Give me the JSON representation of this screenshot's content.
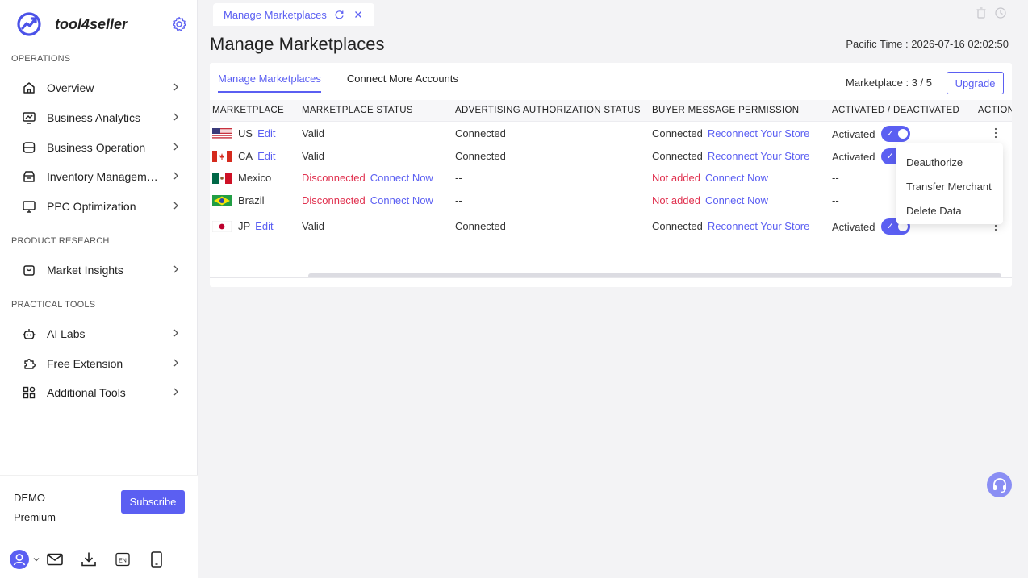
{
  "brand": {
    "name": "tool4seller"
  },
  "sidebar": {
    "sections": [
      {
        "title": "OPERATIONS"
      },
      {
        "title": "PRODUCT RESEARCH"
      },
      {
        "title": "PRACTICAL TOOLS"
      }
    ],
    "items": [
      {
        "label": "Overview",
        "icon": "home-icon"
      },
      {
        "label": "Business Analytics",
        "icon": "analytics-icon"
      },
      {
        "label": "Business Operation",
        "icon": "operation-icon"
      },
      {
        "label": "Inventory Management",
        "icon": "inventory-icon"
      },
      {
        "label": "PPC Optimization",
        "icon": "monitor-icon"
      },
      {
        "label": "Market Insights",
        "icon": "bag-icon"
      },
      {
        "label": "AI Labs",
        "icon": "robot-icon"
      },
      {
        "label": "Free Extension",
        "icon": "puzzle-icon"
      },
      {
        "label": "Additional Tools",
        "icon": "grid-icon"
      }
    ],
    "footer": {
      "plan_name": "DEMO",
      "plan_tier": "Premium",
      "subscribe_label": "Subscribe",
      "lang_label": "EN"
    }
  },
  "tabbar": {
    "tab_label": "Manage Marketplaces"
  },
  "header": {
    "title": "Manage Marketplaces",
    "pacific_time": "Pacific Time : 2026-07-16 02:02:50"
  },
  "card": {
    "subtabs": [
      "Manage Marketplaces",
      "Connect More Accounts"
    ],
    "marketplace_count": "Marketplace : 3 / 5",
    "upgrade_label": "Upgrade",
    "columns": [
      "MARKETPLACE",
      "MARKETPLACE STATUS",
      "ADVERTISING AUTHORIZATION STATUS",
      "BUYER MESSAGE PERMISSION",
      "ACTIVATED / DEACTIVATED",
      "ACTION"
    ],
    "rows": [
      {
        "flag": "us",
        "name": "US",
        "edit": "Edit",
        "status": "Valid",
        "status_link": "",
        "ad_status": "Connected",
        "buyer": "Connected",
        "buyer_link": "Reconnect Your Store",
        "activated": "Activated"
      },
      {
        "flag": "ca",
        "name": "CA",
        "edit": "Edit",
        "status": "Valid",
        "status_link": "",
        "ad_status": "Connected",
        "buyer": "Connected",
        "buyer_link": "Reconnect Your Store",
        "activated": "Activated"
      },
      {
        "flag": "mx",
        "name": "Mexico",
        "edit": "",
        "status": "Disconnected",
        "status_link": "Connect Now",
        "ad_status": "--",
        "buyer": "Not added",
        "buyer_link": "Connect Now",
        "activated": "--"
      },
      {
        "flag": "br",
        "name": "Brazil",
        "edit": "",
        "status": "Disconnected",
        "status_link": "Connect Now",
        "ad_status": "--",
        "buyer": "Not added",
        "buyer_link": "Connect Now",
        "activated": "--"
      },
      {
        "flag": "jp",
        "name": "JP",
        "edit": "Edit",
        "status": "Valid",
        "status_link": "",
        "ad_status": "Connected",
        "buyer": "Connected",
        "buyer_link": "Reconnect Your Store",
        "activated": "Activated"
      }
    ],
    "action_menu": [
      "Deauthorize",
      "Transfer Merchant",
      "Delete Data"
    ]
  },
  "colors": {
    "accent": "#5b5ff2",
    "danger": "#e0304e",
    "sidebar_bg": "#ffffff",
    "page_bg": "#f3f3f5"
  }
}
